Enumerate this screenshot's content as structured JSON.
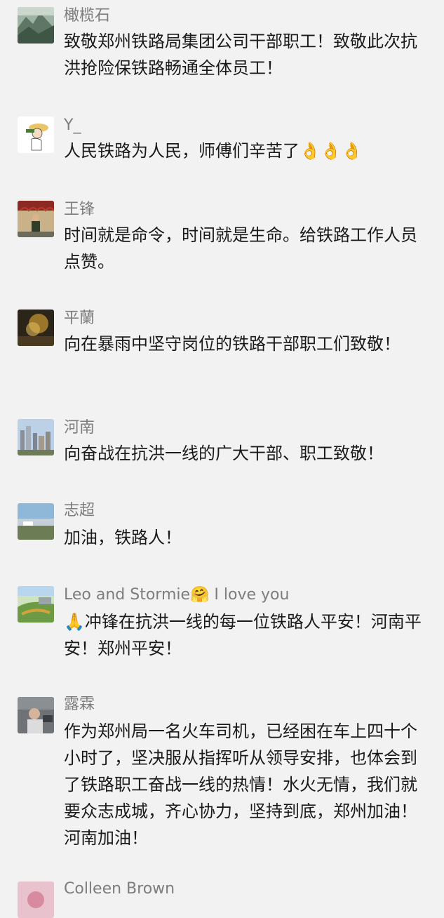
{
  "comments": [
    {
      "name": "橄榄石",
      "text": "致敬郑州铁路局集团公司干部职工！致敬此次抗洪抢险保铁路畅通全体员工！"
    },
    {
      "name": "Y_",
      "text": "人民铁路为人民，师傅们辛苦了",
      "emoji": "👌👌👌"
    },
    {
      "name": "王锋",
      "text": "时间就是命令，时间就是生命。给铁路工作人员点赞。"
    },
    {
      "name": "平蘭",
      "text": "向在暴雨中坚守岗位的铁路干部职工们致敬！"
    },
    {
      "name": "河南",
      "text": "向奋战在抗洪一线的广大干部、职工致敬！"
    },
    {
      "name": "志超",
      "text": "加油，铁路人！"
    },
    {
      "name": "Leo and Stormie",
      "name_emoji": "🤗",
      "name_suffix": " I love you",
      "emoji": "🙏",
      "text": "冲锋在抗洪一线的每一位铁路人平安！河南平安！郑州平安！"
    },
    {
      "name": "露霖",
      "text": "作为郑州局一名火车司机，已经困在车上四十个小时了，坚决服从指挥听从领导安排，也体会到了铁路职工奋战一线的热情！水火无情，我们就要众志成城，齐心协力，坚持到底，郑州加油！河南加油！"
    },
    {
      "name": "Colleen Brown",
      "text": ""
    }
  ]
}
